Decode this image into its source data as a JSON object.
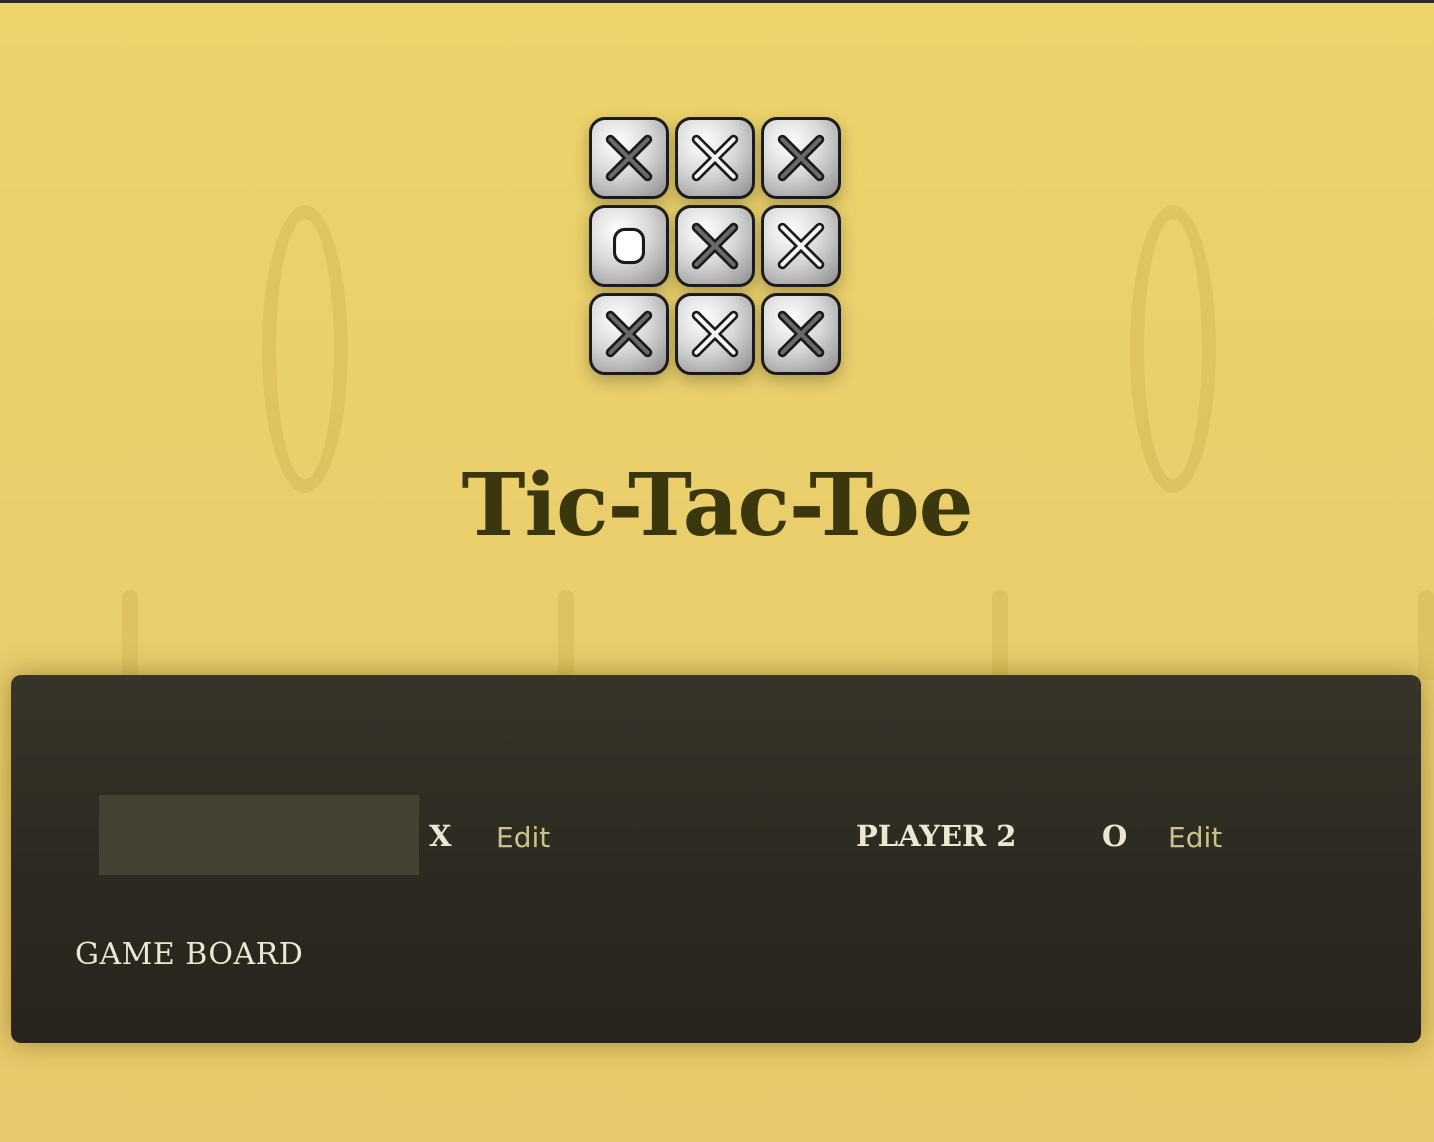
{
  "header": {
    "title": "Tic-Tac-Toe"
  },
  "logo": {
    "tiles": [
      "X",
      "X",
      "X",
      "O",
      "X",
      "X",
      "X",
      "X",
      "X"
    ]
  },
  "players": [
    {
      "name": "",
      "symbol": "X",
      "edit_label": "Edit",
      "editing": true
    },
    {
      "name": "PLAYER 2",
      "symbol": "O",
      "edit_label": "Edit",
      "editing": false
    }
  ],
  "board": {
    "label": "GAME BOARD"
  },
  "colors": {
    "background": "#ecd36a",
    "title": "#3a360d",
    "card": "#2d2b21",
    "input": "#434233",
    "edit_link": "#c9c08a"
  }
}
